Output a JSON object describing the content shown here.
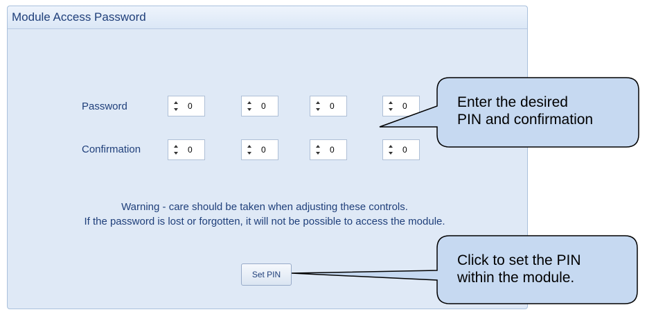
{
  "panel": {
    "title": "Module Access Password"
  },
  "form": {
    "password_label": "Password",
    "confirmation_label": "Confirmation",
    "password_digits": [
      "0",
      "0",
      "0",
      "0"
    ],
    "confirmation_digits": [
      "0",
      "0",
      "0",
      "0"
    ]
  },
  "warning": {
    "line1": "Warning - care should be taken when adjusting these controls.",
    "line2": "If the password is lost or forgotten, it will not be possible to access the module."
  },
  "set_pin_label": "Set PIN",
  "callouts": {
    "enter_line1": "Enter the desired",
    "enter_line2": "PIN and confirmation",
    "click_line1": "Click to set the PIN",
    "click_line2": "within the module."
  },
  "colors": {
    "panel_bg": "#dfe9f6",
    "panel_border": "#a9c0dc",
    "text": "#1f3f7a",
    "callout_fill": "#c6d9f1"
  }
}
